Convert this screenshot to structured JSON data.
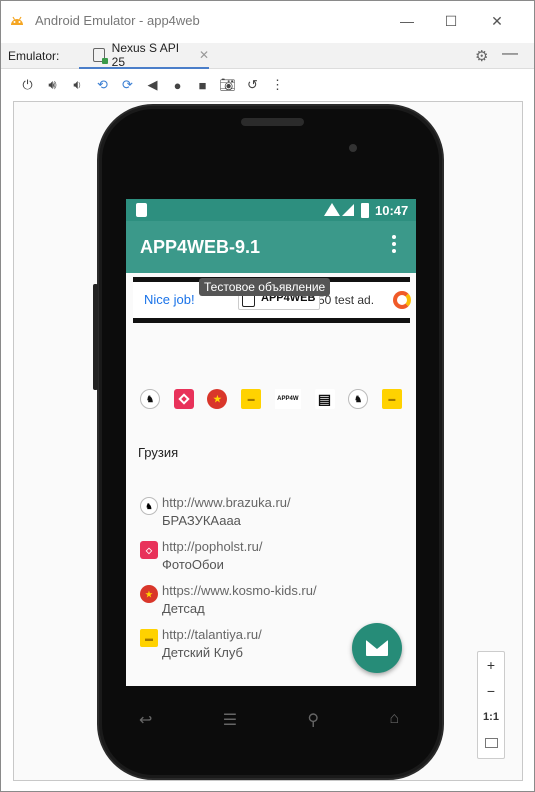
{
  "window": {
    "title": "Android Emulator - app4web",
    "controls": {
      "minimize": "—",
      "maximize": "☐",
      "close": "✕"
    }
  },
  "tabbar": {
    "label": "Emulator:",
    "tab_name": "Nexus S API 25",
    "tab_close": "✕",
    "settings_icon": "gear-icon",
    "minimize": "—"
  },
  "toolbar": {
    "items": [
      "power-icon",
      "volume-up-icon",
      "volume-down-icon",
      "rotate-left-icon",
      "rotate-right-icon",
      "back-icon",
      "home-icon",
      "overview-icon",
      "camera-icon",
      "snapshot-icon",
      "more-icon"
    ]
  },
  "phone": {
    "status": {
      "time": "10:47"
    },
    "app_title": "APP4WEB-9.1",
    "ad": {
      "nice_job": "Nice job!",
      "test_ad": "50 test ad.",
      "brand": "APP4WEB"
    },
    "tooltip": "Тестовое объявление",
    "country": "Грузия",
    "entries": [
      {
        "url": "http://www.brazuka.ru/",
        "name": "БРАЗУКАааа"
      },
      {
        "url": "http://popholst.ru/",
        "name": "ФотоОбои"
      },
      {
        "url": "https://www.kosmo-kids.ru/",
        "name": "Детсад"
      },
      {
        "url": "http://talantiya.ru/",
        "name": "Детский Клуб"
      }
    ],
    "strip_icons": [
      "brazuka-icon",
      "photo-icon",
      "kosmo-icon",
      "talantiya-icon",
      "app4web-icon",
      "clipboard-icon",
      "brazuka-icon",
      "talantiya-icon"
    ]
  },
  "zoom": {
    "plus": "+",
    "minus": "−",
    "one_to_one": "1:1"
  },
  "colors": {
    "statusbar": "#2d8f7f",
    "appbar": "#3b998a",
    "fab": "#268c78",
    "tab_accent": "#4a7ec9"
  }
}
